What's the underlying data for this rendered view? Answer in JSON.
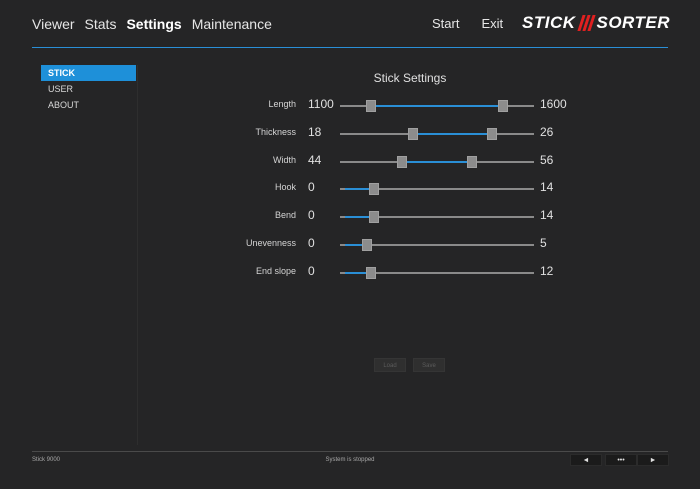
{
  "nav": {
    "items": [
      {
        "label": "Viewer",
        "active": false
      },
      {
        "label": "Stats",
        "active": false
      },
      {
        "label": "Settings",
        "active": true
      },
      {
        "label": "Maintenance",
        "active": false
      }
    ],
    "start_label": "Start",
    "exit_label": "Exit"
  },
  "logo": {
    "left": "STICK",
    "right": "SORTER"
  },
  "colors": {
    "accent": "#1e90d9",
    "background": "#252526",
    "logo_slash": "#e02020"
  },
  "sidebar": {
    "items": [
      {
        "label": "STICK",
        "active": true
      },
      {
        "label": "USER",
        "active": false
      },
      {
        "label": "ABOUT",
        "active": false
      }
    ]
  },
  "panel": {
    "title": "Stick Settings",
    "sliders": [
      {
        "label": "Length",
        "min_label": "1100",
        "max_label": "1600",
        "low_fraction": 0.14,
        "high_fraction": 0.86
      },
      {
        "label": "Thickness",
        "min_label": "18",
        "max_label": "26",
        "low_fraction": 0.37,
        "high_fraction": 0.8
      },
      {
        "label": "Width",
        "min_label": "44",
        "max_label": "56",
        "low_fraction": 0.31,
        "high_fraction": 0.69
      },
      {
        "label": "Hook",
        "min_label": "0",
        "max_label": "14",
        "low_fraction": 0.0,
        "high_fraction": 0.16
      },
      {
        "label": "Bend",
        "min_label": "0",
        "max_label": "14",
        "low_fraction": 0.0,
        "high_fraction": 0.16
      },
      {
        "label": "Unevenness",
        "min_label": "0",
        "max_label": "5",
        "low_fraction": 0.0,
        "high_fraction": 0.12
      },
      {
        "label": "End slope",
        "min_label": "0",
        "max_label": "12",
        "low_fraction": 0.0,
        "high_fraction": 0.14
      }
    ],
    "load_label": "Load",
    "save_label": "Save"
  },
  "status": {
    "left": "Stick 9000",
    "middle": "System is stopped",
    "prev_label": "◄",
    "dots_label": "•••",
    "next_label": "►"
  }
}
